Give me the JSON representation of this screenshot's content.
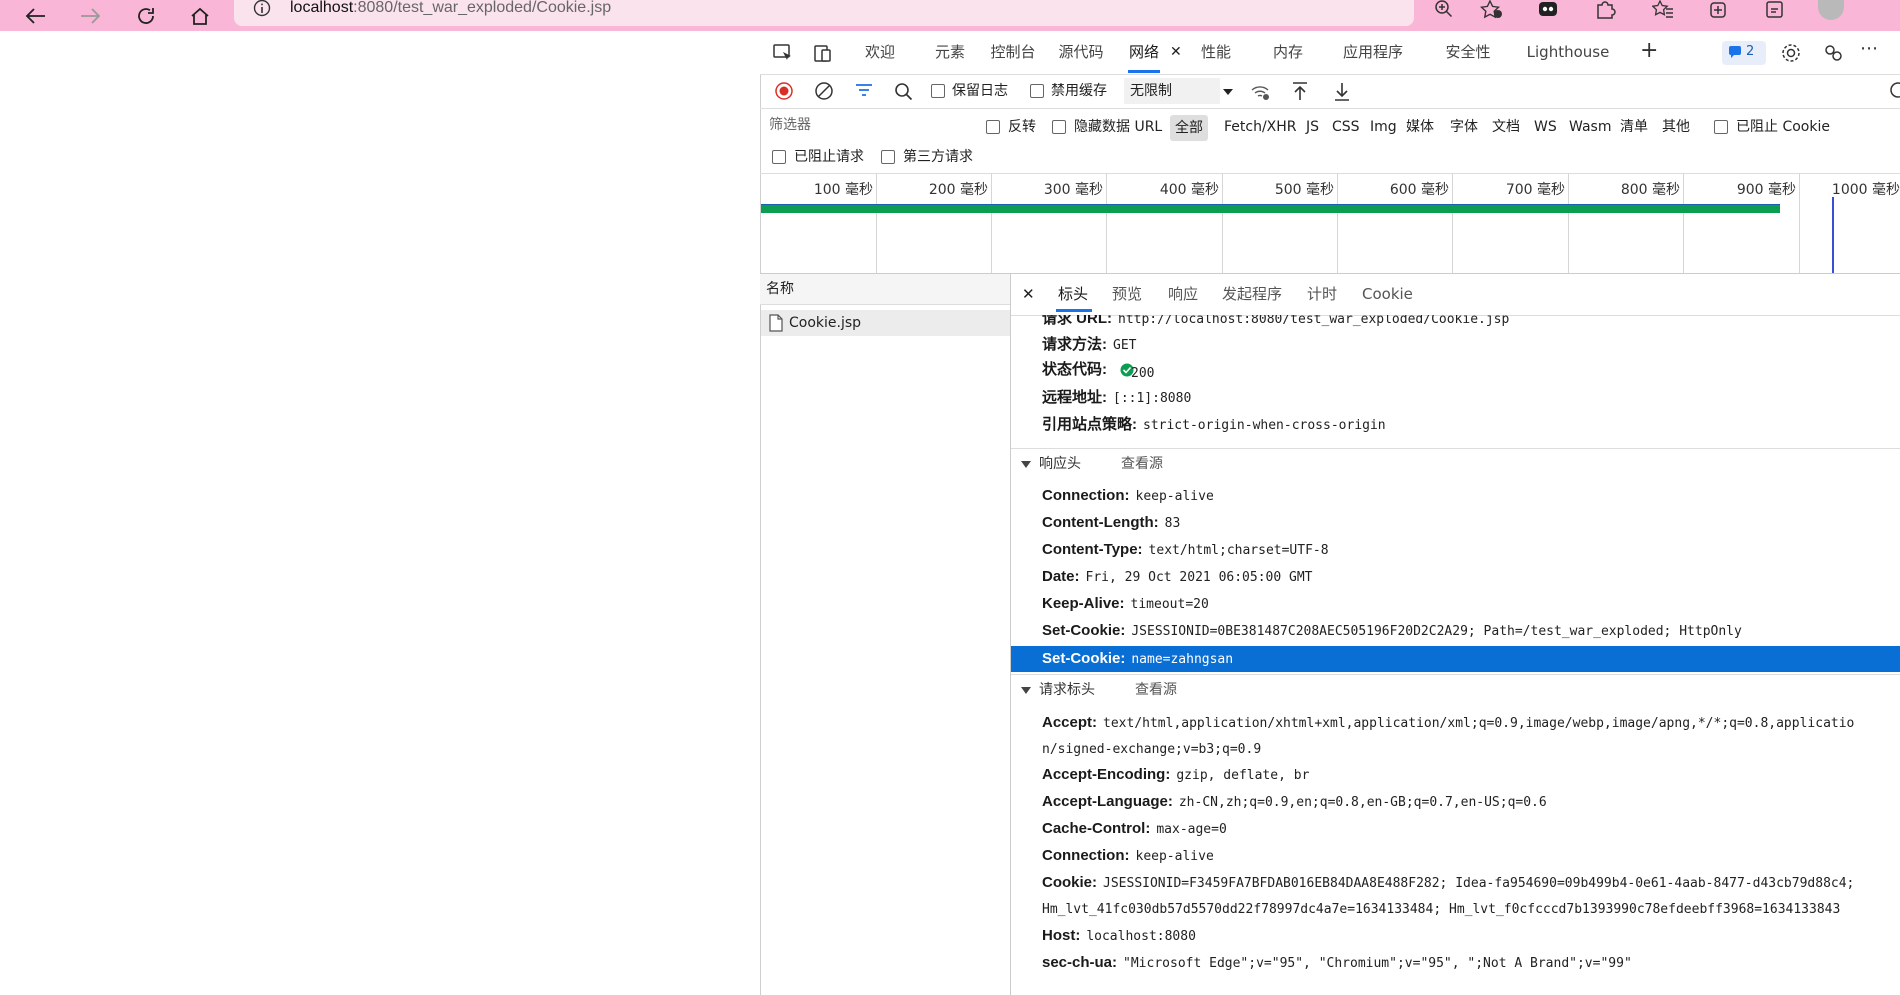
{
  "browser": {
    "url_host": "localhost",
    "url_rest": ":8080/test_war_exploded/Cookie.jsp"
  },
  "devtools": {
    "tabs": [
      "欢迎",
      "元素",
      "控制台",
      "源代码",
      "网络",
      "性能",
      "内存",
      "应用程序",
      "安全性",
      "Lighthouse"
    ],
    "active_tab": "网络",
    "issues_count": "2",
    "toolbar": {
      "preserve_log": "保留日志",
      "disable_cache": "禁用缓存",
      "throttle": "无限制"
    },
    "filter": {
      "placeholder": "筛选器",
      "invert": "反转",
      "hide_data_url": "隐藏数据 URL",
      "types": [
        "全部",
        "Fetch/XHR",
        "JS",
        "CSS",
        "Img",
        "媒体",
        "字体",
        "文档",
        "WS",
        "Wasm",
        "清单",
        "其他"
      ],
      "blocked_cookies": "已阻止 Cookie",
      "blocked_requests": "已阻止请求",
      "third_party": "第三方请求"
    },
    "timeline_ticks": [
      "100 毫秒",
      "200 毫秒",
      "300 毫秒",
      "400 毫秒",
      "500 毫秒",
      "600 毫秒",
      "700 毫秒",
      "800 毫秒",
      "900 毫秒",
      "1000 毫秒"
    ],
    "list": {
      "header": "名称",
      "items": [
        "Cookie.jsp"
      ]
    },
    "detail_tabs": [
      "标头",
      "预览",
      "响应",
      "发起程序",
      "计时",
      "Cookie"
    ],
    "general": [
      {
        "k": "请求 URL:",
        "v": "http://localhost:8080/test_war_exploded/Cookie.jsp"
      },
      {
        "k": "请求方法:",
        "v": "GET"
      },
      {
        "k": "状态代码:",
        "v": "200"
      },
      {
        "k": "远程地址:",
        "v": "[::1]:8080"
      },
      {
        "k": "引用站点策略:",
        "v": "strict-origin-when-cross-origin"
      }
    ],
    "response_section": {
      "title": "响应头",
      "view_source": "查看源"
    },
    "response_headers": [
      {
        "k": "Connection:",
        "v": "keep-alive"
      },
      {
        "k": "Content-Length:",
        "v": "83"
      },
      {
        "k": "Content-Type:",
        "v": "text/html;charset=UTF-8"
      },
      {
        "k": "Date:",
        "v": "Fri, 29 Oct 2021 06:05:00 GMT"
      },
      {
        "k": "Keep-Alive:",
        "v": "timeout=20"
      },
      {
        "k": "Set-Cookie:",
        "v": "JSESSIONID=0BE381487C208AEC505196F20D2C2A29; Path=/test_war_exploded; HttpOnly"
      },
      {
        "k": "Set-Cookie:",
        "v": "name=zahngsan"
      }
    ],
    "request_section": {
      "title": "请求标头",
      "view_source": "查看源"
    },
    "request_headers": [
      {
        "k": "Accept:",
        "v": "text/html,application/xhtml+xml,application/xml;q=0.9,image/webp,image/apng,*/*;q=0.8,applicatio",
        "v2": "n/signed-exchange;v=b3;q=0.9"
      },
      {
        "k": "Accept-Encoding:",
        "v": "gzip, deflate, br"
      },
      {
        "k": "Accept-Language:",
        "v": "zh-CN,zh;q=0.9,en;q=0.8,en-GB;q=0.7,en-US;q=0.6"
      },
      {
        "k": "Cache-Control:",
        "v": "max-age=0"
      },
      {
        "k": "Connection:",
        "v": "keep-alive"
      },
      {
        "k": "Cookie:",
        "v": "JSESSIONID=F3459FA7BFDAB016EB84DAA8E488F282; Idea-fa954690=09b499b4-0e61-4aab-8477-d43cb79d88c4;",
        "v2": "Hm_lvt_41fc030db57d5570dd22f78997dc4a7e=1634133484; Hm_lvt_f0cfcccd7b1393990c78efdeebff3968=1634133843"
      },
      {
        "k": "Host:",
        "v": "localhost:8080"
      },
      {
        "k": "sec-ch-ua:",
        "v": "\"Microsoft Edge\";v=\"95\", \"Chromium\";v=\"95\", \";Not A Brand\";v=\"99\""
      }
    ],
    "colors": {
      "accent": "#1a73e8",
      "highlight": "#0a6fd4",
      "chrome": "#f9b6d6",
      "status_ok": "#0b9e52"
    }
  }
}
